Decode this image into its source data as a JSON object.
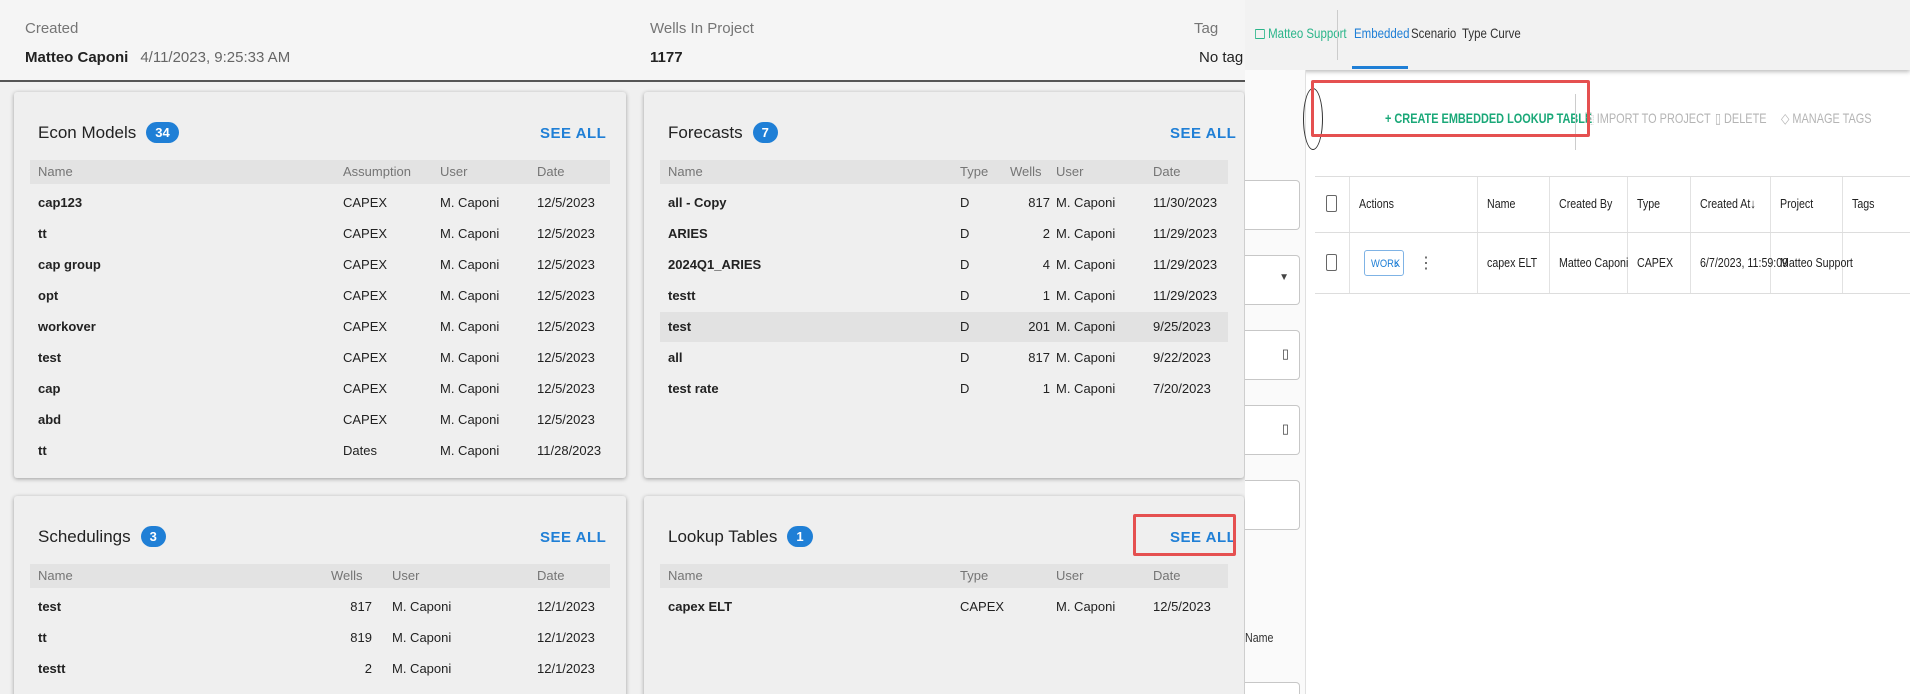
{
  "project_header": {
    "created_label": "Created",
    "created_by": "Matteo Caponi",
    "created_at": "4/11/2023, 9:25:33 AM",
    "wells_label": "Wells In Project",
    "wells_value": "1177",
    "tags_label": "Tag",
    "tags_value": "No tag"
  },
  "econ_models": {
    "title": "Econ Models",
    "count": "34",
    "see_all": "SEE ALL",
    "columns": [
      "Name",
      "Assumption",
      "User",
      "Date"
    ],
    "rows": [
      [
        "cap123",
        "CAPEX",
        "M. Caponi",
        "12/5/2023"
      ],
      [
        "tt",
        "CAPEX",
        "M. Caponi",
        "12/5/2023"
      ],
      [
        "cap group",
        "CAPEX",
        "M. Caponi",
        "12/5/2023"
      ],
      [
        "opt",
        "CAPEX",
        "M. Caponi",
        "12/5/2023"
      ],
      [
        "workover",
        "CAPEX",
        "M. Caponi",
        "12/5/2023"
      ],
      [
        "test",
        "CAPEX",
        "M. Caponi",
        "12/5/2023"
      ],
      [
        "cap",
        "CAPEX",
        "M. Caponi",
        "12/5/2023"
      ],
      [
        "abd",
        "CAPEX",
        "M. Caponi",
        "12/5/2023"
      ],
      [
        "tt",
        "Dates",
        "M. Caponi",
        "11/28/2023"
      ]
    ]
  },
  "forecasts": {
    "title": "Forecasts",
    "count": "7",
    "see_all": "SEE ALL",
    "columns": [
      "Name",
      "Type",
      "Wells",
      "User",
      "Date"
    ],
    "rows": [
      [
        "all - Copy",
        "D",
        "817",
        "M. Caponi",
        "11/30/2023"
      ],
      [
        "ARIES",
        "D",
        "2",
        "M. Caponi",
        "11/29/2023"
      ],
      [
        "2024Q1_ARIES",
        "D",
        "4",
        "M. Caponi",
        "11/29/2023"
      ],
      [
        "testt",
        "D",
        "1",
        "M. Caponi",
        "11/29/2023"
      ],
      [
        "test",
        "D",
        "201",
        "M. Caponi",
        "9/25/2023"
      ],
      [
        "all",
        "D",
        "817",
        "M. Caponi",
        "9/22/2023"
      ],
      [
        "test rate",
        "D",
        "1",
        "M. Caponi",
        "7/20/2023"
      ]
    ]
  },
  "schedulings": {
    "title": "Schedulings",
    "count": "3",
    "see_all": "SEE ALL",
    "columns": [
      "Name",
      "Wells",
      "User",
      "Date"
    ],
    "rows": [
      [
        "test",
        "817",
        "M. Caponi",
        "12/1/2023"
      ],
      [
        "tt",
        "819",
        "M. Caponi",
        "12/1/2023"
      ],
      [
        "testt",
        "2",
        "M. Caponi",
        "12/1/2023"
      ]
    ]
  },
  "lookup_tables": {
    "title": "Lookup Tables",
    "count": "1",
    "see_all": "SEE ALL",
    "columns": [
      "Name",
      "Type",
      "User",
      "Date"
    ],
    "rows": [
      [
        "capex ELT",
        "CAPEX",
        "M. Caponi",
        "12/5/2023"
      ]
    ]
  },
  "lookup_panel": {
    "breadcrumb": "Matteo Support",
    "tabs": [
      "Embedded",
      "Scenario",
      "Type Curve"
    ],
    "active_tab": "Embedded",
    "actions": {
      "create": "CREATE EMBEDDED LOOKUP TABLE",
      "import": "IMPORT TO PROJECT",
      "delete": "DELETE",
      "manage_tags": "MANAGE TAGS"
    },
    "side_label": "Name",
    "grid_columns": [
      "Actions",
      "Name",
      "Created By",
      "Type",
      "Created At",
      "Project",
      "Tags"
    ],
    "grid_rows": [
      {
        "work_label": "WORK",
        "name": "capex ELT",
        "created_by": "Matteo Caponi",
        "type": "CAPEX",
        "created_at": "6/7/2023, 11:59:09",
        "project": "Matteo Support",
        "tags": ""
      }
    ]
  },
  "colors": {
    "accent": "#1f7fd6",
    "create_green": "#1aa878",
    "highlight_red": "#e55050"
  }
}
